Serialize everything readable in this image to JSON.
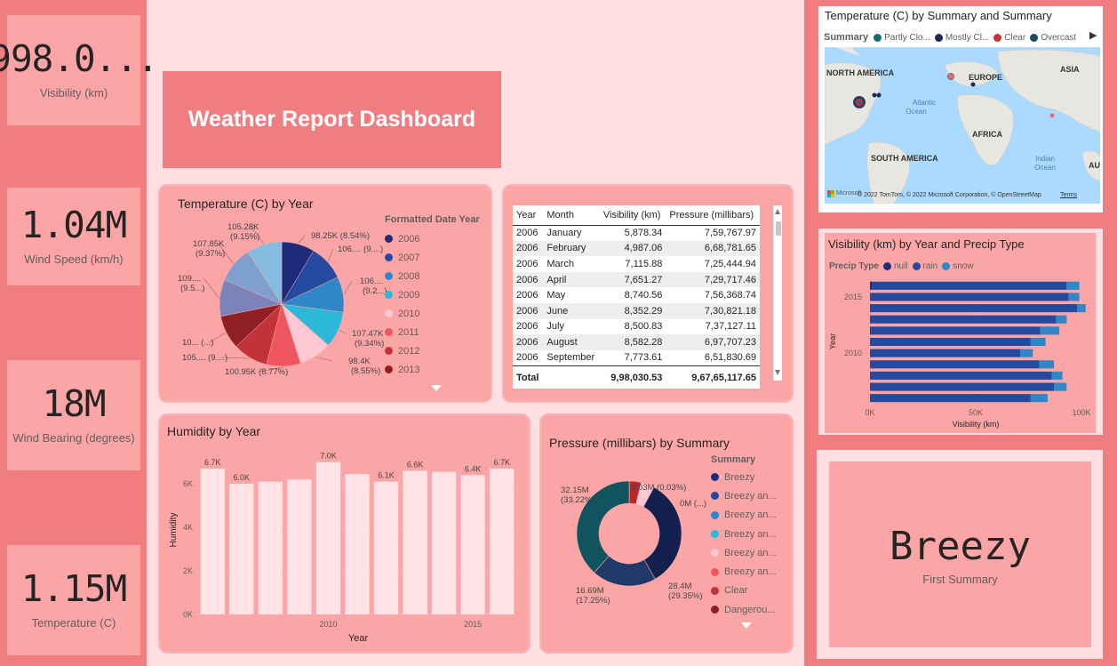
{
  "kpis": [
    {
      "value": "998.0...",
      "label": "Visibility (km)"
    },
    {
      "value": "1.04M",
      "label": "Wind Speed (km/h)"
    },
    {
      "value": "18M",
      "label": "Wind Bearing (degrees)"
    },
    {
      "value": "1.15M",
      "label": "Temperature (C)"
    }
  ],
  "dashboard_title": "Weather Report Dashboard",
  "pie_card": {
    "title": "Temperature (C) by Year",
    "legend_title": "Formatted Date Year",
    "legend": [
      "2006",
      "2007",
      "2008",
      "2009",
      "2010",
      "2011",
      "2012",
      "2013"
    ],
    "colors": [
      "#1f2a7a",
      "#244aa0",
      "#2f86c8",
      "#2cb8d8",
      "#ffc7d1",
      "#ef5660",
      "#c23339",
      "#8f1f24",
      "#7b83b8",
      "#7fa0cf",
      "#84bde0"
    ],
    "labels": [
      {
        "l1": "98.25K (8.54%)",
        "l2": ""
      },
      {
        "l1": "106.... (9....)",
        "l2": ""
      },
      {
        "l1": "106....",
        "l2": "(9.2...)"
      },
      {
        "l1": "107.47K",
        "l2": "(9.34%)"
      },
      {
        "l1": "98.4K",
        "l2": "(8.55%)"
      },
      {
        "l1": "100.95K (8.77%)",
        "l2": ""
      },
      {
        "l1": "105.... (9....)",
        "l2": ""
      },
      {
        "l1": "10... (...)",
        "l2": ""
      },
      {
        "l1": "109....",
        "l2": "(9.5...)"
      },
      {
        "l1": "107.85K",
        "l2": "(9.37%)"
      },
      {
        "l1": "105.28K",
        "l2": "(9.15%)"
      }
    ]
  },
  "table": {
    "headers": [
      "Year",
      "Month",
      "Visibility (km)",
      "Pressure (millibars)"
    ],
    "rows": [
      [
        "2006",
        "January",
        "5,878.34",
        "7,59,767.97"
      ],
      [
        "2006",
        "February",
        "4,987.06",
        "6,68,781.65"
      ],
      [
        "2006",
        "March",
        "7,115.88",
        "7,25,444.94"
      ],
      [
        "2006",
        "April",
        "7,651.27",
        "7,29,717.46"
      ],
      [
        "2006",
        "May",
        "8,740.56",
        "7,56,368.74"
      ],
      [
        "2006",
        "June",
        "8,352.29",
        "7,30,821.18"
      ],
      [
        "2006",
        "July",
        "8,500.83",
        "7,37,127.11"
      ],
      [
        "2006",
        "August",
        "8,582.28",
        "6,97,707.23"
      ],
      [
        "2006",
        "September",
        "7,773.61",
        "6,51,830.69"
      ]
    ],
    "total_label": "Total",
    "total_visibility": "9,98,030.53",
    "total_pressure": "9,67,65,117.65"
  },
  "map": {
    "title": "Temperature (C) by Summary and Summary",
    "legend_title": "Summary",
    "legend": [
      {
        "label": "Partly Clo...",
        "color": "#1d6b6e"
      },
      {
        "label": "Mostly Cl...",
        "color": "#1a2a55"
      },
      {
        "label": "Clear",
        "color": "#c23339"
      },
      {
        "label": "Overcast",
        "color": "#1b4d5e"
      }
    ],
    "regions": [
      "NORTH AMERICA",
      "EUROPE",
      "ASIA",
      "AFRICA",
      "SOUTH AMERICA",
      "AU"
    ],
    "oceans": [
      {
        "l1": "Atlantic",
        "l2": "Ocean"
      },
      {
        "l1": "Indian",
        "l2": "Ocean"
      }
    ],
    "attribution": "© 2022 TomTom, © 2022 Microsoft Corporation, © OpenStreetMap",
    "terms": "Terms",
    "ms_label": "Microsoft"
  },
  "vis_card": {
    "title": "Visibility (km) by Year and Precip Type",
    "legend_title": "Precip Type",
    "legend": [
      {
        "label": "null",
        "color": "#1f2a7a"
      },
      {
        "label": "rain",
        "color": "#244aa0"
      },
      {
        "label": "snow",
        "color": "#2f86c8"
      }
    ]
  },
  "humidity_card": {
    "title": "Humidity by Year"
  },
  "pressure_card": {
    "title": "Pressure (millibars) by Summary",
    "legend_title": "Summary",
    "legend": [
      {
        "label": "Breezy",
        "color": "#1f2a7a"
      },
      {
        "label": "Breezy an...",
        "color": "#244aa0"
      },
      {
        "label": "Breezy an...",
        "color": "#2f86c8"
      },
      {
        "label": "Breezy an...",
        "color": "#2cb8d8"
      },
      {
        "label": "Breezy an...",
        "color": "#ffc7d1"
      },
      {
        "label": "Breezy an...",
        "color": "#ef5660"
      },
      {
        "label": "Clear",
        "color": "#c23339"
      },
      {
        "label": "Dangerou...",
        "color": "#8f1f24"
      }
    ],
    "labels": [
      {
        "l1": "0.03M (0.03%)",
        "l2": ""
      },
      {
        "l1": "0M (...)",
        "l2": ""
      },
      {
        "l1": "28.4M",
        "l2": "(29.35%)"
      },
      {
        "l1": "16.69M",
        "l2": "(17.25%)"
      },
      {
        "l1": "32.15M",
        "l2": "(33.22%)"
      }
    ]
  },
  "breezy": {
    "value": "Breezy",
    "label": "First Summary"
  },
  "chart_data": [
    {
      "type": "pie",
      "title": "Temperature (C) by Year",
      "legend_title": "Formatted Date Year",
      "series_label": "Formatted Date Year",
      "categories": [
        "2006",
        "2007",
        "2008",
        "2009",
        "2010",
        "2011",
        "2012",
        "2013",
        "2014",
        "2015",
        "2016"
      ],
      "values": [
        98.25,
        106.0,
        106.0,
        107.47,
        98.4,
        100.95,
        105.0,
        100.0,
        109.0,
        107.85,
        105.28
      ],
      "value_unit": "K",
      "percentages": [
        8.54,
        9.2,
        9.2,
        9.34,
        8.55,
        8.77,
        9.1,
        8.7,
        9.5,
        9.37,
        9.15
      ]
    },
    {
      "type": "bar",
      "title": "Humidity by Year",
      "xlabel": "Year",
      "ylabel": "Humidity",
      "categories": [
        "2006",
        "2007",
        "2008",
        "2009",
        "2010",
        "2011",
        "2012",
        "2013",
        "2014",
        "2015",
        "2016"
      ],
      "values": [
        6.7,
        6.0,
        6.1,
        6.2,
        7.0,
        6.45,
        6.1,
        6.6,
        6.55,
        6.4,
        6.7
      ],
      "value_unit": "K",
      "data_labels": [
        "6.7K",
        "6.0K",
        "",
        "",
        "7.0K",
        "",
        "6.1K",
        "6.6K",
        "",
        "6.4K",
        "6.7K"
      ],
      "yticks": [
        "0K",
        "2K",
        "4K",
        "6K"
      ],
      "xticks": [
        "2010",
        "2015"
      ],
      "ylim": [
        0,
        7.6
      ]
    },
    {
      "type": "bar",
      "orientation": "horizontal",
      "stacked": true,
      "title": "Visibility (km) by Year and Precip Type",
      "xlabel": "Visibility (km)",
      "ylabel": "Year",
      "categories": [
        "2016",
        "2015",
        "2014",
        "2013",
        "2012",
        "2011",
        "2010",
        "2009",
        "2008",
        "2007",
        "2006"
      ],
      "series": [
        {
          "name": "null",
          "values": [
            1.0,
            0,
            0,
            0,
            0.5,
            0,
            0,
            0,
            0,
            0,
            0
          ]
        },
        {
          "name": "rain",
          "values": [
            92.0,
            94.0,
            98.0,
            88.0,
            80.0,
            76.0,
            71.0,
            80.0,
            86.0,
            87.0,
            76.0
          ]
        },
        {
          "name": "snow",
          "values": [
            6.0,
            5.0,
            4.0,
            5.0,
            9.0,
            7.0,
            6.0,
            7.0,
            5.0,
            6.0,
            8.0
          ]
        }
      ],
      "value_unit": "K",
      "xticks": [
        "0K",
        "50K",
        "100K"
      ],
      "yticks": [
        "2015",
        "2010"
      ],
      "xlim": [
        0,
        100
      ]
    },
    {
      "type": "pie",
      "subtype": "donut",
      "title": "Pressure (millibars) by Summary",
      "legend_title": "Summary",
      "categories": [
        "Breezy",
        "Breezy an...",
        "Breezy an...",
        "Breezy an...",
        "Breezy an...",
        "Breezy an...",
        "Clear",
        "Dangerou...",
        "...",
        "...",
        "..."
      ],
      "values": [
        0.03,
        0.01,
        0.01,
        0.01,
        0.01,
        0.01,
        28.4,
        16.69,
        32.15,
        3.5,
        3.0
      ],
      "value_unit": "M"
    }
  ]
}
